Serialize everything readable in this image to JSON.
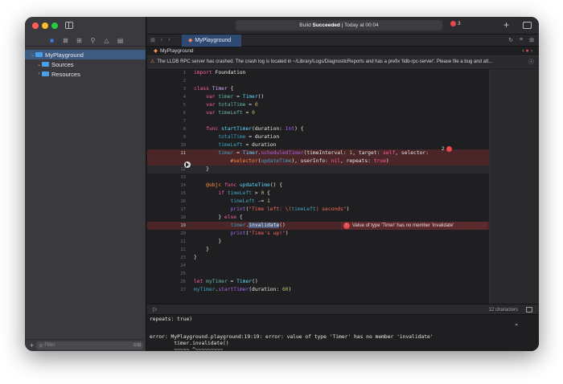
{
  "sidebar": {
    "traffic_lights": [
      "#ff5f57",
      "#febc2e",
      "#28c840"
    ],
    "nav_icons": [
      "folder-icon",
      "x-square-icon",
      "hierarchy-icon",
      "search-icon",
      "warning-icon",
      "doc-icon"
    ],
    "tree": [
      {
        "label": "MyPlayground",
        "expanded": true,
        "selected": true
      },
      {
        "label": "Sources",
        "expanded": true
      },
      {
        "label": "Resources",
        "expanded": false
      }
    ],
    "filter_placeholder": "Filter"
  },
  "toolbar": {
    "status_prefix": "Build ",
    "status_strong": "Succeeded",
    "status_suffix": " | Today at 00:04",
    "error_count": "3"
  },
  "tab": {
    "label": "MyPlayground"
  },
  "jumpbar": {
    "label": "MyPlayground"
  },
  "warning": {
    "text": "The LLDB RPC server has crashed. The crash log is located in ~/Library/Logs/DiagnosticReports and has a prefix 'lldb-rpc-server'. Please file a bug and att..."
  },
  "editor": {
    "line_numbers": [
      "1",
      "2",
      "3",
      "4",
      "5",
      "6",
      "7",
      "8",
      "9",
      "10",
      "11",
      "",
      "12",
      "13",
      "14",
      "15",
      "16",
      "17",
      "18",
      "19",
      "20",
      "21",
      "22",
      "23",
      "24",
      "25",
      "26",
      "27"
    ],
    "error_line_count": "2",
    "invalidate_error": "Value of type 'Timer' has no member 'invalidate'"
  },
  "debug": {
    "char_count": "12 characters"
  },
  "console": {
    "lines": [
      "repeats: true)",
      "",
      "error: MyPlayground.playground:19:19: error: value of type 'Timer' has no member 'invalidate'",
      "        timer.invalidate()",
      "        ~~~~~ ^~~~~~~~~~"
    ]
  }
}
